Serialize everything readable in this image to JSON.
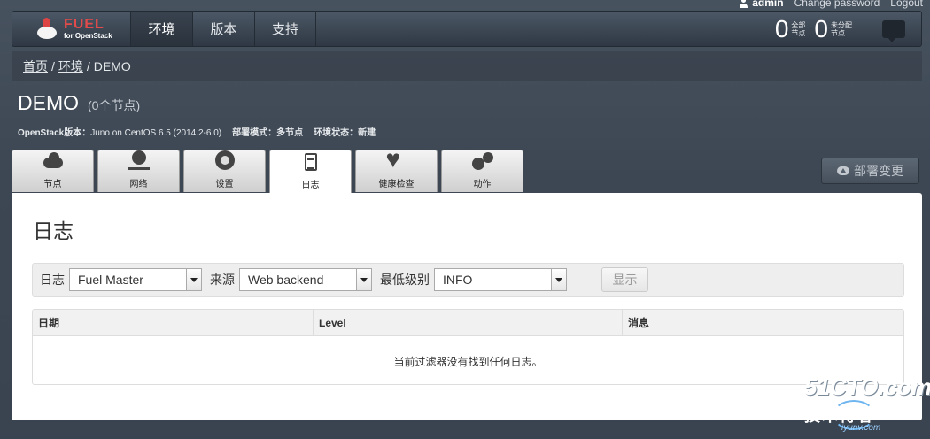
{
  "user": {
    "name": "admin",
    "change_password": "Change password",
    "logout": "Logout"
  },
  "brand": {
    "title": "FUEL",
    "subtitle": "for OpenStack"
  },
  "nav": {
    "items": [
      "环境",
      "版本",
      "支持"
    ],
    "active_index": 0
  },
  "counters": [
    {
      "value": "0",
      "label_line1": "全部",
      "label_line2": "节点"
    },
    {
      "value": "0",
      "label_line1": "未分配",
      "label_line2": "节点"
    }
  ],
  "breadcrumb": {
    "home": "首页",
    "env": "环境",
    "sep": "/",
    "current": "DEMO"
  },
  "env": {
    "name": "DEMO",
    "nodes": "(0个节点)",
    "openstack_label": "OpenStack版本：",
    "openstack_value": "Juno on CentOS 6.5 (2014.2-6.0)",
    "mode_label": "部署模式：",
    "mode_value": "多节点",
    "status_label": "环境状态：",
    "status_value": "新建"
  },
  "tabs": [
    {
      "label": "节点",
      "icon": "cloud-icon"
    },
    {
      "label": "网络",
      "icon": "network-icon"
    },
    {
      "label": "设置",
      "icon": "gear-icon"
    },
    {
      "label": "日志",
      "icon": "clipboard-icon"
    },
    {
      "label": "健康检查",
      "icon": "heart-icon"
    },
    {
      "label": "动作",
      "icon": "gears-icon"
    }
  ],
  "active_tab": 3,
  "deploy_button": "部署变更",
  "logs": {
    "heading": "日志",
    "filter_log_label": "日志",
    "filter_log_value": "Fuel Master",
    "filter_source_label": "来源",
    "filter_source_value": "Web backend",
    "filter_level_label": "最低级别",
    "filter_level_value": "INFO",
    "show_button": "显示",
    "columns": [
      "日期",
      "Level",
      "消息"
    ],
    "empty_message": "当前过滤器没有找到任何日志。"
  },
  "watermark": {
    "site": "51CTO.com",
    "line2": "技术博客",
    "line3": "运维网",
    "url": "iyunv.com"
  }
}
